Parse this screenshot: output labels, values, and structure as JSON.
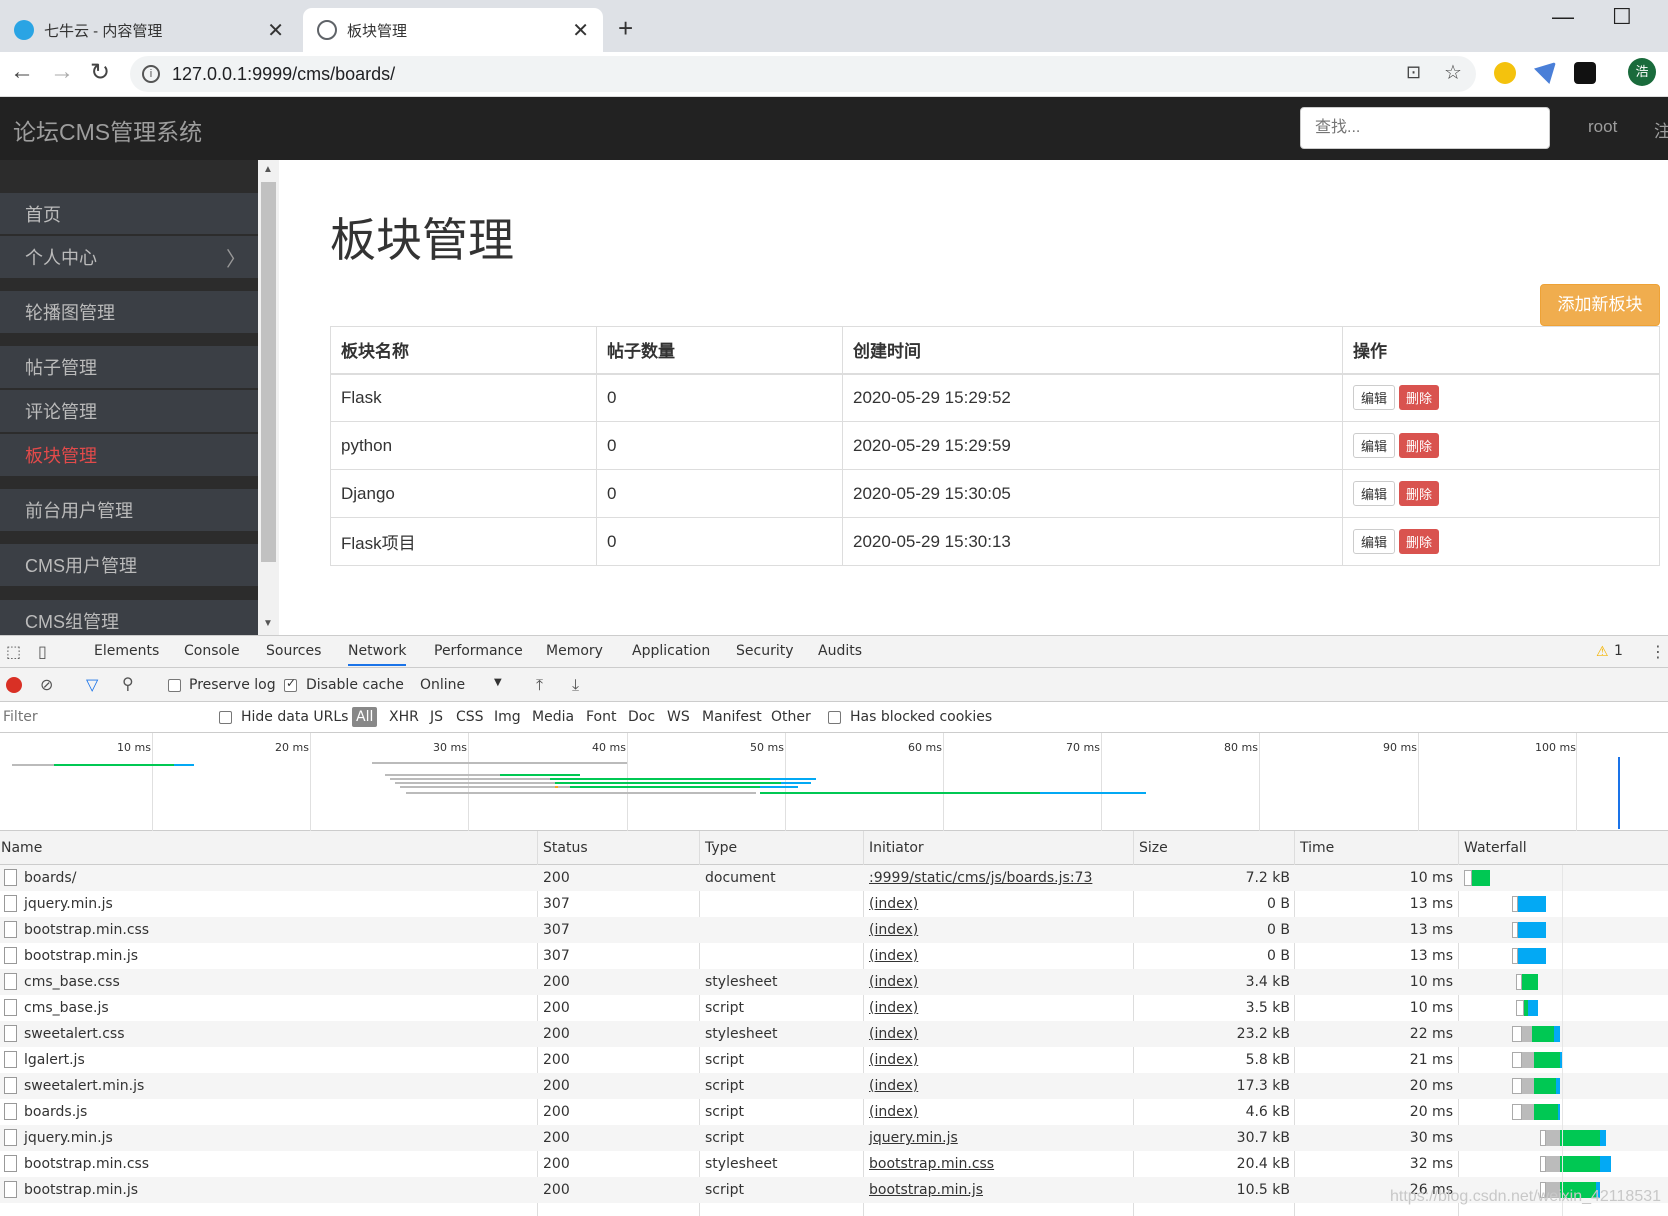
{
  "browser": {
    "tabs": [
      {
        "title": "七牛云 - 内容管理",
        "close": "✕"
      },
      {
        "title": "板块管理",
        "close": "✕"
      }
    ],
    "new_tab": "+",
    "window": {
      "minimize": "—",
      "maximize": "☐"
    },
    "nav": {
      "back": "←",
      "forward": "→",
      "reload": "↻"
    },
    "url_info": "i",
    "url": "127.0.0.1:9999/cms/boards/",
    "translate": "⊡",
    "bookmark": "☆",
    "profile_initial": "浩",
    "menu": "⋮"
  },
  "app": {
    "brand": "论坛CMS管理系统",
    "search_placeholder": "查找...",
    "user": "root",
    "logout": "注"
  },
  "sidebar": {
    "items": [
      {
        "label": "首页"
      },
      {
        "label": "个人中心",
        "chevron": "〉"
      },
      {
        "label": "轮播图管理"
      },
      {
        "label": "帖子管理"
      },
      {
        "label": "评论管理"
      },
      {
        "label": "板块管理",
        "active": true
      },
      {
        "label": "前台用户管理"
      },
      {
        "label": "CMS用户管理"
      },
      {
        "label": "CMS组管理"
      }
    ],
    "scroll_up": "▲",
    "scroll_down": "▼"
  },
  "main": {
    "title": "板块管理",
    "add_button": "添加新板块",
    "columns": [
      "板块名称",
      "帖子数量",
      "创建时间",
      "操作"
    ],
    "rows": [
      {
        "name": "Flask",
        "count": "0",
        "created": "2020-05-29 15:29:52"
      },
      {
        "name": "python",
        "count": "0",
        "created": "2020-05-29 15:29:59"
      },
      {
        "name": "Django",
        "count": "0",
        "created": "2020-05-29 15:30:05"
      },
      {
        "name": "Flask项目",
        "count": "0",
        "created": "2020-05-29 15:30:13"
      }
    ],
    "edit_label": "编辑",
    "delete_label": "删除"
  },
  "devtools": {
    "tabs": [
      "Elements",
      "Console",
      "Sources",
      "Network",
      "Performance",
      "Memory",
      "Application",
      "Security",
      "Audits"
    ],
    "active_tab": "Network",
    "warning_icon": "⚠",
    "warnings": "1",
    "menu": "⋮",
    "preserve_log": "Preserve log",
    "disable_cache": "Disable cache",
    "throttle": "Online",
    "throttle_arrow": "▼",
    "filter_placeholder": "Filter",
    "hide_data_urls": "Hide data URLs",
    "types": [
      "All",
      "XHR",
      "JS",
      "CSS",
      "Img",
      "Media",
      "Font",
      "Doc",
      "WS",
      "Manifest",
      "Other"
    ],
    "blocked_cookies": "Has blocked cookies",
    "ticks": [
      "10 ms",
      "20 ms",
      "30 ms",
      "40 ms",
      "50 ms",
      "60 ms",
      "70 ms",
      "80 ms",
      "90 ms",
      "100 ms"
    ],
    "columns": [
      "Name",
      "Status",
      "Type",
      "Initiator",
      "Size",
      "Time",
      "Waterfall"
    ],
    "requests": [
      {
        "name": "boards/",
        "status": "200",
        "type": "document",
        "initiator": ":9999/static/cms/js/boards.js:73",
        "size": "7.2 kB",
        "time": "10 ms"
      },
      {
        "name": "jquery.min.js",
        "status": "307",
        "type": "",
        "initiator": "(index)",
        "size": "0 B",
        "time": "13 ms"
      },
      {
        "name": "bootstrap.min.css",
        "status": "307",
        "type": "",
        "initiator": "(index)",
        "size": "0 B",
        "time": "13 ms"
      },
      {
        "name": "bootstrap.min.js",
        "status": "307",
        "type": "",
        "initiator": "(index)",
        "size": "0 B",
        "time": "13 ms"
      },
      {
        "name": "cms_base.css",
        "status": "200",
        "type": "stylesheet",
        "initiator": "(index)",
        "size": "3.4 kB",
        "time": "10 ms"
      },
      {
        "name": "cms_base.js",
        "status": "200",
        "type": "script",
        "initiator": "(index)",
        "size": "3.5 kB",
        "time": "10 ms"
      },
      {
        "name": "sweetalert.css",
        "status": "200",
        "type": "stylesheet",
        "initiator": "(index)",
        "size": "23.2 kB",
        "time": "22 ms"
      },
      {
        "name": "lgalert.js",
        "status": "200",
        "type": "script",
        "initiator": "(index)",
        "size": "5.8 kB",
        "time": "21 ms"
      },
      {
        "name": "sweetalert.min.js",
        "status": "200",
        "type": "script",
        "initiator": "(index)",
        "size": "17.3 kB",
        "time": "20 ms"
      },
      {
        "name": "boards.js",
        "status": "200",
        "type": "script",
        "initiator": "(index)",
        "size": "4.6 kB",
        "time": "20 ms"
      },
      {
        "name": "jquery.min.js",
        "status": "200",
        "type": "script",
        "initiator": "jquery.min.js",
        "size": "30.7 kB",
        "time": "30 ms"
      },
      {
        "name": "bootstrap.min.css",
        "status": "200",
        "type": "stylesheet",
        "initiator": "bootstrap.min.css",
        "size": "20.4 kB",
        "time": "32 ms"
      },
      {
        "name": "bootstrap.min.js",
        "status": "200",
        "type": "script",
        "initiator": "bootstrap.min.js",
        "size": "10.5 kB",
        "time": "26 ms"
      }
    ]
  },
  "watermark": "https://blog.csdn.net/weixin_42118531",
  "colors": {
    "accent": "#1a73e8",
    "danger": "#d9534f",
    "warning": "#f0ad4e",
    "download": "#03a9f4",
    "waiting": "#00c853"
  }
}
